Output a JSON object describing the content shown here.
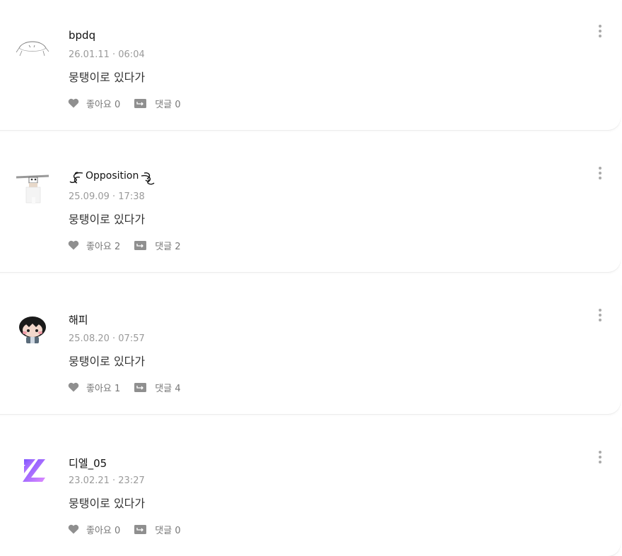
{
  "posts": [
    {
      "username": "bpdq",
      "timestamp": "26.01.11 · 06:04",
      "content": "뭉탱이로 있다가",
      "likes": "좋아요 0",
      "comments": "댓글 0",
      "avatar_icon": "scribble-avatar-icon"
    },
    {
      "username": "Opposition",
      "timestamp": "25.09.09 · 17:38",
      "content": "뭉탱이로 있다가",
      "likes": "좋아요 2",
      "comments": "댓글 2",
      "avatar_icon": "hat-character-avatar-icon"
    },
    {
      "username": "해피",
      "timestamp": "25.08.20 · 07:57",
      "content": "뭉탱이로 있다가",
      "likes": "좋아요 1",
      "comments": "댓글 4",
      "avatar_icon": "chibi-character-avatar-icon"
    },
    {
      "username": "디엘_05",
      "timestamp": "23.02.21 · 23:27",
      "content": "뭉탱이로 있다가",
      "likes": "좋아요 0",
      "comments": "댓글 0",
      "avatar_icon": "logo-avatar-icon"
    }
  ],
  "colors": {
    "icon_gray": "#8f8f8f",
    "meta_gray": "#9a9a9a",
    "logo_purple": "#7b5cff",
    "logo_pink": "#d67cff"
  }
}
